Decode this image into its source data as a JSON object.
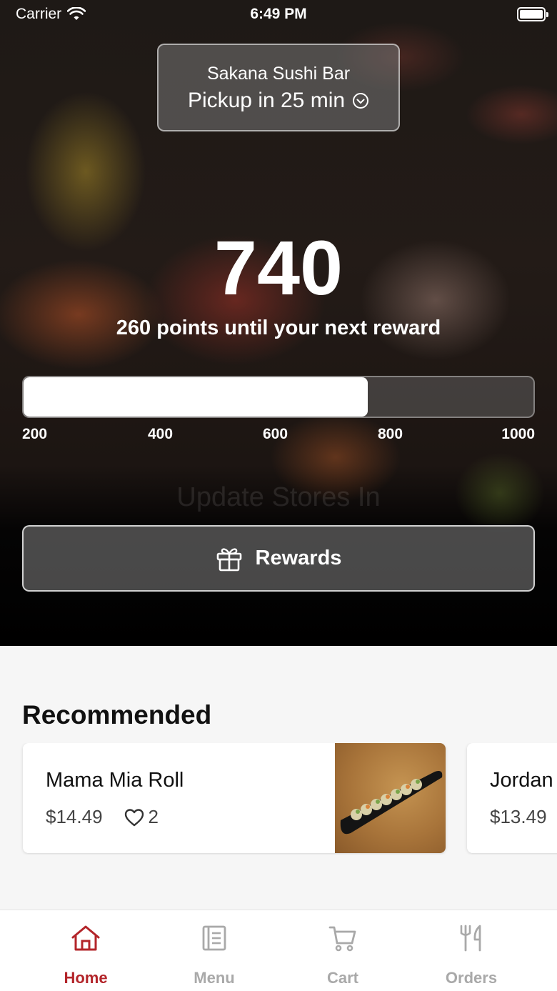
{
  "status_bar": {
    "carrier": "Carrier",
    "time": "6:49 PM"
  },
  "store": {
    "name": "Sakana Sushi Bar",
    "pickup": "Pickup in 25 min"
  },
  "points": {
    "value": "740",
    "subtitle": "260 points until your next reward",
    "progress_fraction": 0.675,
    "ticks": [
      "200",
      "400",
      "600",
      "800",
      "1000"
    ]
  },
  "ghost_text": "Update Stores In",
  "rewards_button": {
    "label": "Rewards",
    "icon": "gift-icon"
  },
  "recommended": {
    "title": "Recommended",
    "items": [
      {
        "name": "Mama Mia Roll",
        "price": "$14.49",
        "likes": "2"
      },
      {
        "name": "Jordan",
        "price": "$13.49",
        "likes": ""
      }
    ]
  },
  "tabbar": {
    "active_color": "#b3252a",
    "inactive_color": "#a9a9a9",
    "tabs": [
      {
        "label": "Home",
        "icon": "home-icon",
        "active": true
      },
      {
        "label": "Menu",
        "icon": "menu-icon",
        "active": false
      },
      {
        "label": "Cart",
        "icon": "cart-icon",
        "active": false
      },
      {
        "label": "Orders",
        "icon": "fork-knife-icon",
        "active": false
      }
    ]
  }
}
